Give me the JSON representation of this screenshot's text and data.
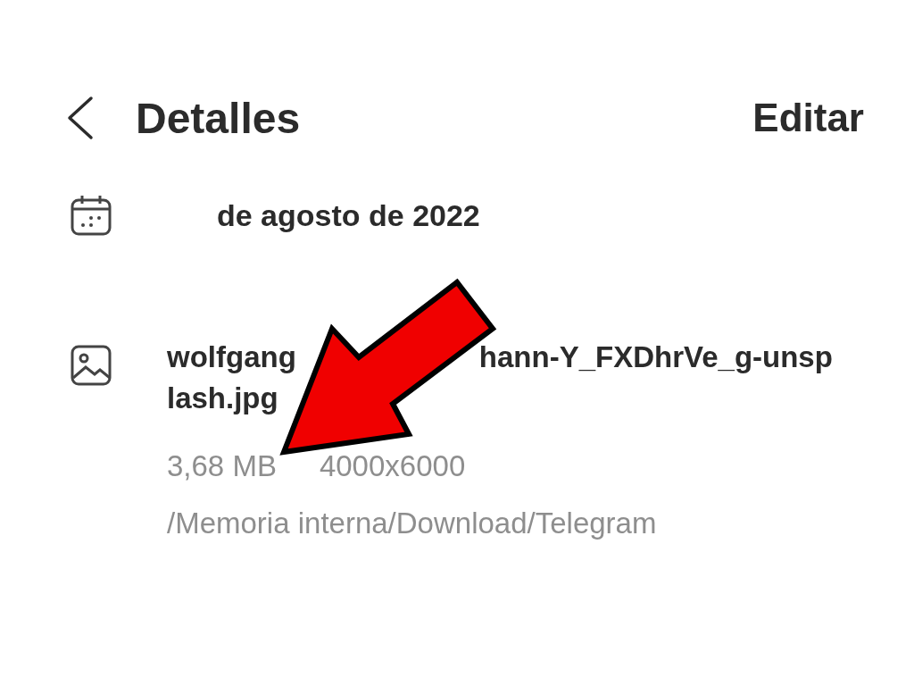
{
  "header": {
    "title": "Detalles",
    "action": "Editar"
  },
  "date": {
    "text": "de agosto de 2022"
  },
  "file": {
    "name_parts": [
      "wolfgang",
      "hann-Y_FXDhrVe_g-unsp",
      "lash.jpg"
    ],
    "size": "3,68 MB",
    "resolution": "4000x6000",
    "path": "/Memoria interna/Download/Telegram"
  }
}
